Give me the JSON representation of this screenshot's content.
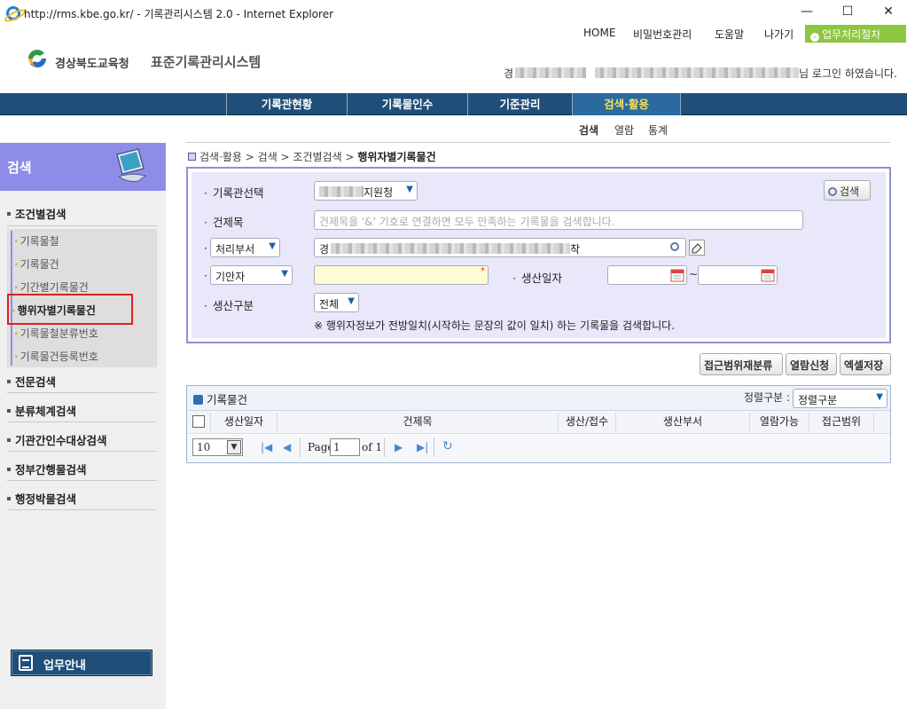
{
  "window": {
    "title": "http://rms.kbe.go.kr/ - 기록관리시스템 2.0 - Internet Explorer",
    "minimize": "—",
    "maximize": "☐",
    "close": "✕"
  },
  "topnav": {
    "home": "HOME",
    "password": "비밀번호관리",
    "help": "도움말",
    "logout": "나가기",
    "procedure": "업무처리절차"
  },
  "header": {
    "org": "경상북도교육청",
    "system": "표준기록관리시스템",
    "user_prefix": "경",
    "user_suffix": "님 로그인 하였습니다."
  },
  "mainnav": {
    "items": [
      "기록관현황",
      "기록물인수",
      "기준관리",
      "검색·활용"
    ]
  },
  "subnav": {
    "items": [
      "검색",
      "열람",
      "통계"
    ]
  },
  "sidebar": {
    "title": "검색",
    "section1": "조건별검색",
    "sub_items": [
      "기록물철",
      "기록물건",
      "기간별기록물건",
      "행위자별기록물건",
      "기록물철분류번호",
      "기록물건등록번호"
    ],
    "sections": [
      "전문검색",
      "분류체계검색",
      "기관간인수대상검색",
      "정부간행물검색",
      "행정박물검색"
    ],
    "guide": "업무안내"
  },
  "breadcrumb": {
    "path": "검색·활용 > 검색 > 조건별검색 > ",
    "current": "행위자별기록물건"
  },
  "form": {
    "archive_label": "기록관선택",
    "archive_value_suffix": "지원청",
    "title_label": "건제목",
    "title_placeholder": "건제목을 '&' 기호로 연결하면 모두 만족하는 기록물을 검색합니다.",
    "dept_select": "처리부서",
    "dept_value_prefix": "경",
    "dept_value_suffix": "착",
    "author_select": "기안자",
    "date_label": "생산일자",
    "date_sep": "~",
    "prod_label": "생산구분",
    "prod_value": "전체",
    "search_button": "검색",
    "note": "※ 행위자정보가 전방일치(시작하는 문장의 값이 일치) 하는 기록물을 검색합니다.",
    "required_mark": "*"
  },
  "actions": {
    "reclassify": "접근범위재분류",
    "request": "열람신청",
    "excel": "엑셀저장"
  },
  "grid": {
    "title": "기록물건",
    "sort_label": "정렬구분 :",
    "sort_value": "정렬구분",
    "columns": [
      "생산일자",
      "건제목",
      "생산/접수",
      "생산부서",
      "열람가능",
      "접근범위"
    ],
    "page_size": "10",
    "page_label": "Page",
    "page_value": "1",
    "page_of": "of 1"
  }
}
